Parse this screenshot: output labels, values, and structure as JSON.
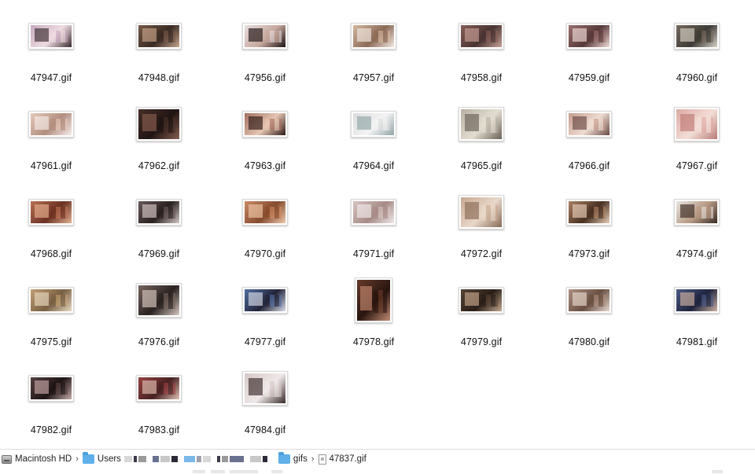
{
  "files": [
    {
      "name": "47947.gif",
      "colors": [
        "#c9a7c0",
        "#3b2c2f",
        "#f0dbe1"
      ],
      "aspect": "wide"
    },
    {
      "name": "47948.gif",
      "colors": [
        "#7b5a45",
        "#c8a58a",
        "#3a2a22"
      ],
      "aspect": "wide"
    },
    {
      "name": "47956.gif",
      "colors": [
        "#e8dde0",
        "#1e1414",
        "#c9a79b"
      ],
      "aspect": "wide"
    },
    {
      "name": "47957.gif",
      "colors": [
        "#d9b79e",
        "#f3e9e1",
        "#8e6a55"
      ],
      "aspect": "wide"
    },
    {
      "name": "47958.gif",
      "colors": [
        "#8a5d55",
        "#c9a095",
        "#4a3232"
      ],
      "aspect": "wide"
    },
    {
      "name": "47959.gif",
      "colors": [
        "#a07070",
        "#f0dcd8",
        "#5a3838"
      ],
      "aspect": "wide"
    },
    {
      "name": "47960.gif",
      "colors": [
        "#7a6a5e",
        "#d9d2c8",
        "#3e3a34"
      ],
      "aspect": "wide"
    },
    {
      "name": "47961.gif",
      "colors": [
        "#e8c8b8",
        "#f6ecea",
        "#b58e7e"
      ],
      "aspect": "wide"
    },
    {
      "name": "47962.gif",
      "colors": [
        "#4a3028",
        "#8a5e4e",
        "#201412"
      ],
      "aspect": "square"
    },
    {
      "name": "47963.gif",
      "colors": [
        "#a86e5e",
        "#2e1a16",
        "#e8c4b0"
      ],
      "aspect": "wide"
    },
    {
      "name": "47964.gif",
      "colors": [
        "#dcdcdc",
        "#8fa4a8",
        "#f3f3f3"
      ],
      "aspect": "wide"
    },
    {
      "name": "47965.gif",
      "colors": [
        "#b8b0a2",
        "#6a6054",
        "#e4ddd0"
      ],
      "aspect": "square"
    },
    {
      "name": "47966.gif",
      "colors": [
        "#c89a8a",
        "#6a4a44",
        "#f0dcd0"
      ],
      "aspect": "wide"
    },
    {
      "name": "47967.gif",
      "colors": [
        "#e0a8a0",
        "#c07a74",
        "#f4ddd6"
      ],
      "aspect": "square"
    },
    {
      "name": "47968.gif",
      "colors": [
        "#c07050",
        "#e8b090",
        "#703020"
      ],
      "aspect": "wide"
    },
    {
      "name": "47969.gif",
      "colors": [
        "#6a5a5a",
        "#d8c8c8",
        "#2a2020"
      ],
      "aspect": "wide"
    },
    {
      "name": "47970.gif",
      "colors": [
        "#d08a60",
        "#f0c8a8",
        "#8a4a2a"
      ],
      "aspect": "wide"
    },
    {
      "name": "47971.gif",
      "colors": [
        "#d8c4c0",
        "#f2eaea",
        "#a88a86"
      ],
      "aspect": "wide"
    },
    {
      "name": "47972.gif",
      "colors": [
        "#c8a890",
        "#8a6a54",
        "#ead8c8"
      ],
      "aspect": "square"
    },
    {
      "name": "47973.gif",
      "colors": [
        "#b08060",
        "#e8d0b8",
        "#4a3020"
      ],
      "aspect": "wide"
    },
    {
      "name": "47974.gif",
      "colors": [
        "#e8e4e0",
        "#3a2a22",
        "#b89880"
      ],
      "aspect": "wide"
    },
    {
      "name": "47975.gif",
      "colors": [
        "#c8a070",
        "#e8d8c0",
        "#7a6040"
      ],
      "aspect": "wide"
    },
    {
      "name": "47976.gif",
      "colors": [
        "#7a6660",
        "#d8c8c0",
        "#2a2220"
      ],
      "aspect": "square"
    },
    {
      "name": "47977.gif",
      "colors": [
        "#5070a8",
        "#d8dce8",
        "#22243a"
      ],
      "aspect": "wide"
    },
    {
      "name": "47978.gif",
      "colors": [
        "#6a3a28",
        "#c88a70",
        "#2a140e"
      ],
      "aspect": "tall"
    },
    {
      "name": "47979.gif",
      "colors": [
        "#5a4434",
        "#c8a88c",
        "#2a1e16"
      ],
      "aspect": "wide"
    },
    {
      "name": "47980.gif",
      "colors": [
        "#b09080",
        "#e8d8cc",
        "#6a5040"
      ],
      "aspect": "wide"
    },
    {
      "name": "47981.gif",
      "colors": [
        "#4a5a8a",
        "#d0b0a0",
        "#1e2440"
      ],
      "aspect": "wide"
    },
    {
      "name": "47982.gif",
      "colors": [
        "#5a4040",
        "#c8a8a8",
        "#1e1414"
      ],
      "aspect": "wide"
    },
    {
      "name": "47983.gif",
      "colors": [
        "#a04040",
        "#e0c0b0",
        "#4a2020"
      ],
      "aspect": "wide"
    },
    {
      "name": "47984.gif",
      "colors": [
        "#d8c8c8",
        "#3a2a2a",
        "#f0e8e8"
      ],
      "aspect": "square"
    }
  ],
  "pathbar": {
    "drive": "Macintosh HD",
    "users": "Users",
    "folder": "gifs",
    "file": "47837.gif",
    "separator": "›",
    "icons": {
      "drive": "hard-drive-icon",
      "folder": "folder-icon",
      "file": "file-icon"
    },
    "redacted_colors": [
      "#d8d8d8",
      "#3a3a4a",
      "#9a9a9a",
      "#6a7090",
      "#c8c8c8",
      "#2a2a3a",
      "#7ab8e8",
      "#a0a0b0"
    ]
  }
}
